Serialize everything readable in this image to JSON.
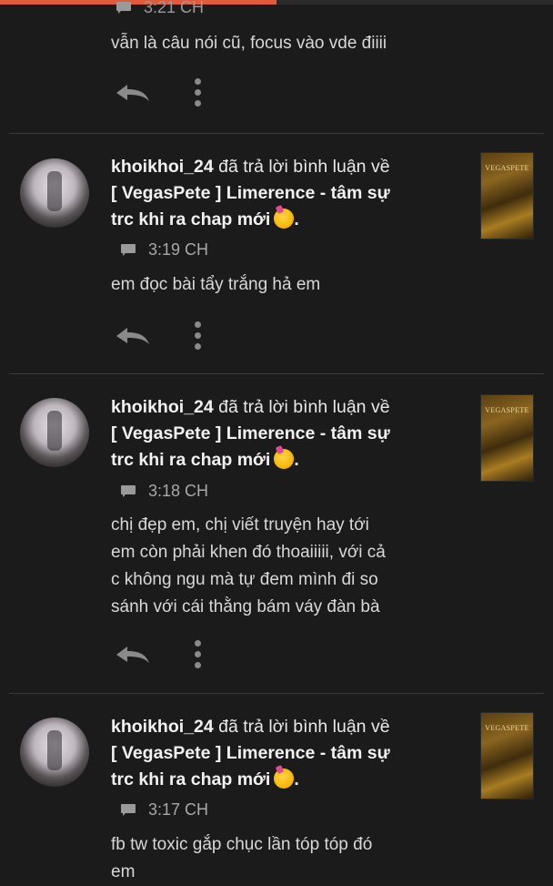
{
  "top_partial": {
    "timestamp": "3:21 CH",
    "comment": "vẫn là câu nói cũ, focus vào vde điiii"
  },
  "notifications": [
    {
      "user": "khoikhoi_24",
      "action": "đã trả lời bình luận về",
      "story_line1": "[ VegasPete ] Limerence - tâm sự",
      "story_line2": "trc khi ra chap mới",
      "dot": ".",
      "time": "3:19 CH",
      "comment_lines": [
        "em đọc bài tẩy trắng hả em"
      ],
      "thumb_title": "VEGASPETE"
    },
    {
      "user": "khoikhoi_24",
      "action": "đã trả lời bình luận về",
      "story_line1": "[ VegasPete ] Limerence - tâm sự",
      "story_line2": "trc khi ra chap mới",
      "dot": ".",
      "time": "3:18 CH",
      "comment_lines": [
        "chị đẹp em, chị viết truyện hay tới",
        "em còn phải khen đó thoaiiiii, với cả",
        "c không ngu mà tự đem mình đi so",
        "sánh với cái thằng bám váy đàn bà"
      ],
      "thumb_title": "VEGASPETE"
    },
    {
      "user": "khoikhoi_24",
      "action": "đã trả lời bình luận về",
      "story_line1": "[ VegasPete ] Limerence - tâm sự",
      "story_line2": "trc khi ra chap mới",
      "dot": ".",
      "time": "3:17 CH",
      "comment_lines": [
        "fb tw toxic gắp chục lần tóp tóp đó",
        "em"
      ],
      "thumb_title": "VEGASPETE"
    }
  ],
  "reading_progress_percent": 50
}
